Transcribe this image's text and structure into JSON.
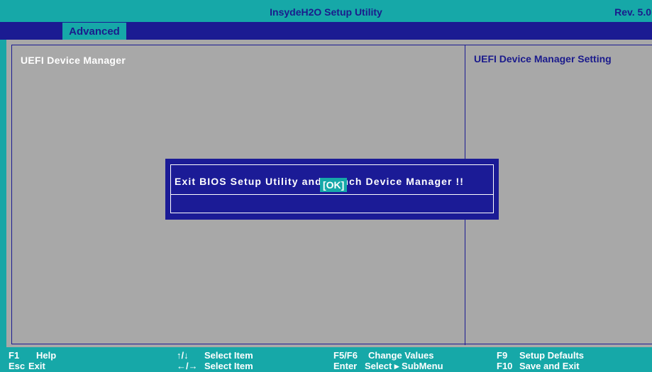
{
  "title_bar": {
    "title": "InsydeH2O Setup Utility",
    "revision": "Rev. 5.0"
  },
  "menu": {
    "tabs": [
      {
        "label": "Advanced",
        "selected": true
      }
    ]
  },
  "main": {
    "heading": "UEFI Device Manager"
  },
  "help_panel": {
    "heading": "UEFI Device Manager Setting"
  },
  "dialog": {
    "message": "Exit BIOS Setup Utility and launch Device Manager !!",
    "ok_label": "[OK]"
  },
  "footer": {
    "keys": [
      {
        "key": "F1",
        "action": "Help"
      },
      {
        "key": "Esc",
        "action": "Exit"
      },
      {
        "key": "↑/↓",
        "action": "Select Item"
      },
      {
        "key": "←/→",
        "action": "Select Item"
      },
      {
        "key": "F5/F6",
        "action": "Change Values"
      },
      {
        "key": "Enter",
        "action": "Select ▸ SubMenu"
      },
      {
        "key": "F9",
        "action": "Setup Defaults"
      },
      {
        "key": "F10",
        "action": "Save and Exit"
      }
    ]
  },
  "colors": {
    "background_teal": "#16a8a8",
    "navy": "#1b1b92",
    "panel_gray": "#a8a8a8",
    "text_white": "#ffffff"
  }
}
